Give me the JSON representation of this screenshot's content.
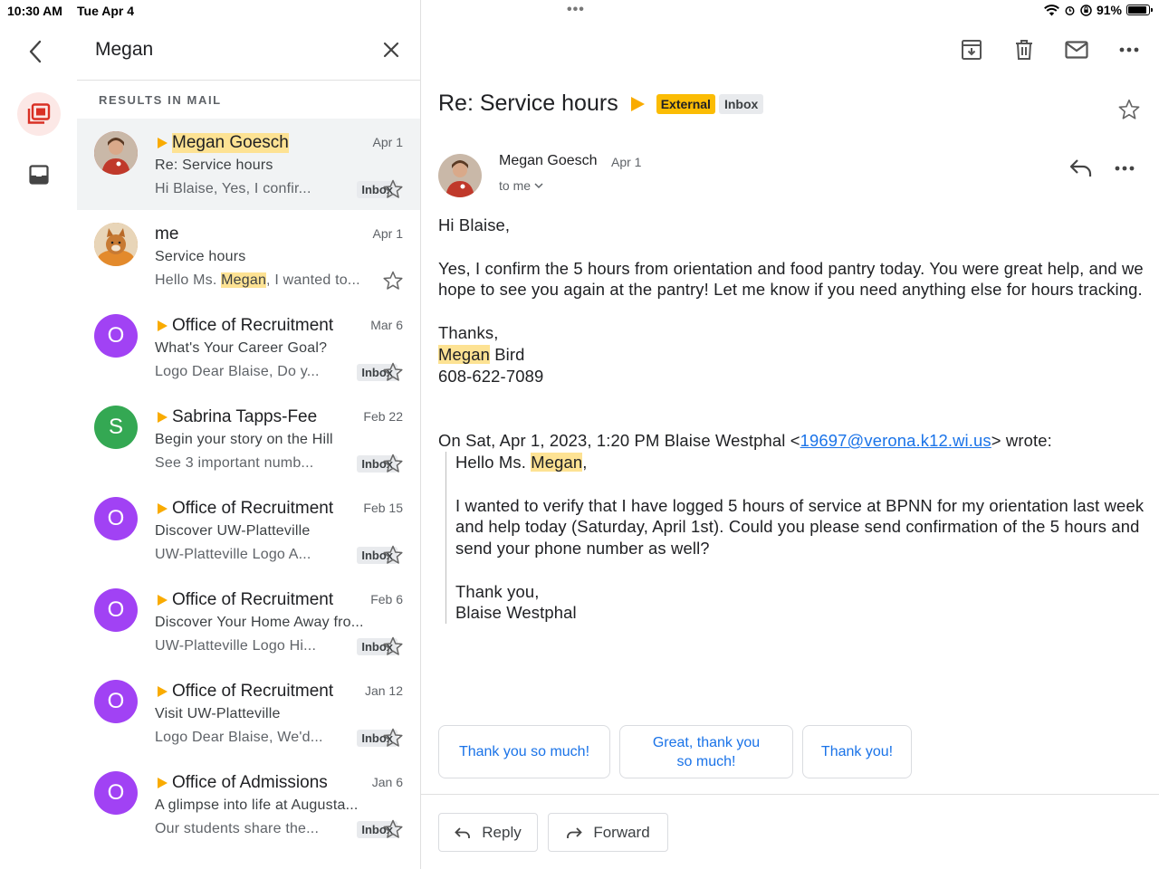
{
  "status": {
    "time": "10:30 AM",
    "date": "Tue Apr 4",
    "battery": "91%",
    "battery_level": 0.91
  },
  "search": {
    "query": "Megan",
    "results_label": "RESULTS IN MAIL"
  },
  "mails": [
    {
      "sender": "Megan Goesch",
      "date": "Apr 1",
      "subject": "Re: Service hours",
      "snippet": "Hi Blaise, Yes, I confir...",
      "chip": "Inbox",
      "important": true,
      "avatar_color": "#c0392b",
      "avatar_letter": ""
    },
    {
      "sender": "me",
      "date": "Apr 1",
      "subject": "Service hours",
      "snippet_pre": "Hello Ms. ",
      "snippet_hl": "Megan",
      "snippet_post": ", I wanted to...",
      "chip": "",
      "important": false,
      "avatar_color": "#d6852c",
      "avatar_letter": ""
    },
    {
      "sender": "Office of Recruitment",
      "date": "Mar 6",
      "subject": "What's Your Career Goal?",
      "snippet": "Logo Dear Blaise, Do y...",
      "chip": "Inbox",
      "important": true,
      "avatar_color": "#a142f4",
      "avatar_letter": "O"
    },
    {
      "sender": "Sabrina Tapps-Fee",
      "date": "Feb 22",
      "subject": "Begin your story on the Hill",
      "snippet": "See 3 important numb...",
      "chip": "Inbox",
      "important": true,
      "avatar_color": "#34a853",
      "avatar_letter": "S"
    },
    {
      "sender": "Office of Recruitment",
      "date": "Feb 15",
      "subject": "Discover UW-Platteville",
      "snippet": "UW-Platteville Logo A...",
      "chip": "Inbox",
      "important": true,
      "avatar_color": "#a142f4",
      "avatar_letter": "O"
    },
    {
      "sender": "Office of Recruitment",
      "date": "Feb 6",
      "subject": "Discover Your Home Away fro...",
      "snippet": "UW-Platteville Logo Hi...",
      "chip": "Inbox",
      "important": true,
      "avatar_color": "#a142f4",
      "avatar_letter": "O"
    },
    {
      "sender": "Office of Recruitment",
      "date": "Jan 12",
      "subject": "Visit UW-Platteville",
      "snippet": "Logo Dear Blaise, We'd...",
      "chip": "Inbox",
      "important": true,
      "avatar_color": "#a142f4",
      "avatar_letter": "O"
    },
    {
      "sender": "Office of Admissions",
      "date": "Jan 6",
      "subject": "A glimpse into life at Augusta...",
      "snippet": "Our students share the...",
      "chip": "Inbox",
      "important": true,
      "avatar_color": "#a142f4",
      "avatar_letter": "O"
    }
  ],
  "message": {
    "title": "Re: Service hours",
    "chip_external": "External",
    "chip_inbox": "Inbox",
    "sender": "Megan Goesch",
    "date": "Apr 1",
    "to": "to me",
    "greeting": "Hi Blaise,",
    "paragraph": "Yes, I confirm the 5 hours from orientation and food pantry today. You were great help, and we hope to see you again at the pantry! Let me know if you need anything else for hours tracking.",
    "thanks": "Thanks,",
    "sig_first": "Megan",
    "sig_last": " Bird",
    "phone": "608-622-7089",
    "quote_header_pre": "On Sat, Apr 1, 2023, 1:20 PM Blaise Westphal <",
    "quote_email": "19697@verona.k12.wi.us",
    "quote_header_post": "> wrote:",
    "quote_greeting_pre": "Hello Ms. ",
    "quote_greeting_hl": "Megan",
    "quote_greeting_post": ",",
    "quote_paragraph": "I wanted to verify that I have logged 5 hours of service at BPNN for my orientation last week and help today (Saturday, April 1st). Could you please send confirmation of the 5 hours and send your phone number as well?",
    "quote_thanks": "Thank you,",
    "quote_sig": "Blaise Westphal"
  },
  "smart_replies": [
    "Thank you so much!",
    "Great, thank you so much!",
    "Thank you!"
  ],
  "actions": {
    "reply": "Reply",
    "forward": "Forward"
  },
  "colors": {
    "accent": "#1a73e8",
    "highlight": "#fde293",
    "important": "#f9ab00",
    "external_chip": "#fbbc04"
  }
}
